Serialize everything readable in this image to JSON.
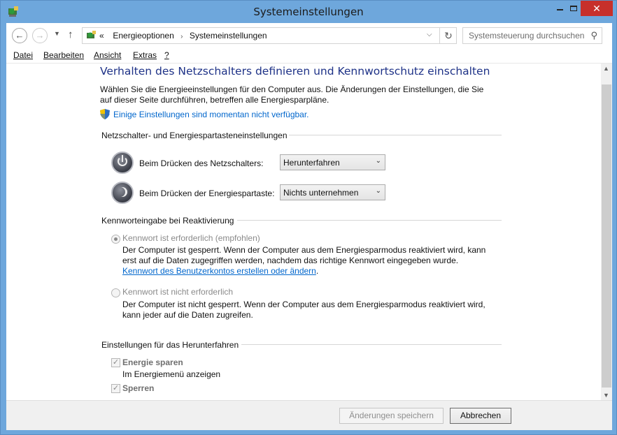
{
  "window": {
    "title": "Systemeinstellungen",
    "close_glyph": "✕"
  },
  "nav": {
    "back_glyph": "←",
    "forward_glyph": "→",
    "recent_glyph": "▼",
    "up_glyph": "↑",
    "breadcrumb": [
      "Energieoptionen",
      "Systemeinstellungen"
    ],
    "breadcrumb_lead": "«",
    "breadcrumb_sep": "›",
    "dropdown_glyph": "⌵",
    "refresh_glyph": "↻",
    "search_placeholder": "Systemsteuerung durchsuchen",
    "search_glyph": "⚲"
  },
  "menu": [
    {
      "label": "Datei"
    },
    {
      "label": "Bearbeiten"
    },
    {
      "label": "Ansicht"
    },
    {
      "label": "Extras"
    },
    {
      "label": "?"
    }
  ],
  "page": {
    "heading": "Verhalten des Netzschalters definieren und Kennwortschutz einschalten",
    "intro": "Wählen Sie die Energieeinstellungen für den Computer aus. Die Änderungen der Einstellungen, die Sie auf dieser Seite durchführen, betreffen alle Energiesparpläne.",
    "uac_link": "Einige Einstellungen sind momentan nicht verfügbar."
  },
  "buttons_section": {
    "title": "Netzschalter- und Energiespartasteneinstellungen",
    "power_label": "Beim Drücken des Netzschalters:",
    "power_value": "Herunterfahren",
    "sleep_label": "Beim Drücken der Energiespartaste:",
    "sleep_value": "Nichts unternehmen",
    "select_arrow": "⌄"
  },
  "password_section": {
    "title": "Kennworteingabe bei Reaktivierung",
    "required_label": "Kennwort ist erforderlich (empfohlen)",
    "required_desc": "Der Computer ist gesperrt. Wenn der Computer aus dem Energiesparmodus reaktiviert wird, kann erst auf die Daten zugegriffen werden, nachdem das richtige Kennwort eingegeben wurde.",
    "required_link": "Kennwort des Benutzerkontos erstellen oder ändern",
    "required_link_suffix": ".",
    "not_required_label": "Kennwort ist nicht erforderlich",
    "not_required_desc": "Der Computer ist nicht gesperrt. Wenn der Computer aus dem Energiesparmodus reaktiviert wird, kann jeder auf die Daten zugreifen.",
    "selected": "required"
  },
  "shutdown_section": {
    "title": "Einstellungen für das Herunterfahren",
    "energy_label": "Energie sparen",
    "energy_sub": "Im Energiemenü anzeigen",
    "lock_label": "Sperren",
    "check_glyph": "✓"
  },
  "scrollbar": {
    "up_glyph": "▲",
    "down_glyph": "▼"
  },
  "footer": {
    "save_label": "Änderungen speichern",
    "cancel_label": "Abbrechen"
  }
}
